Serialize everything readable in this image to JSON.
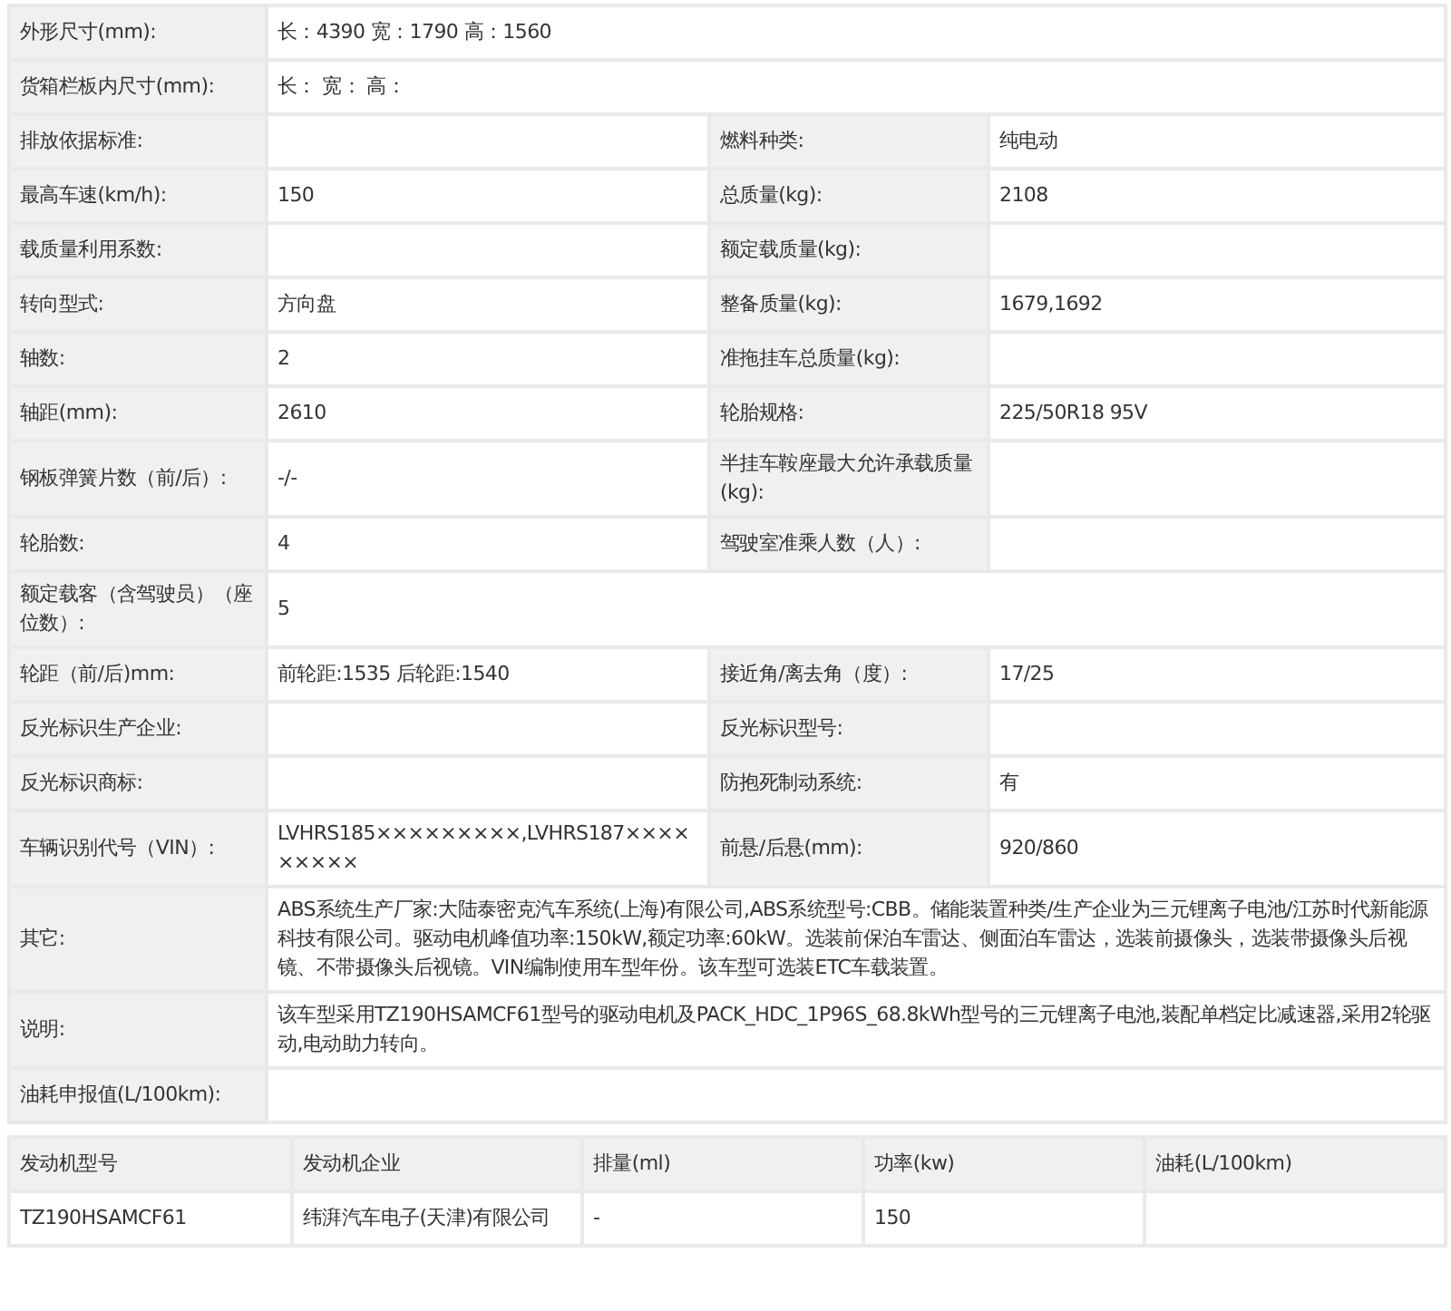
{
  "spec_table": {
    "rows": [
      {
        "cells": [
          {
            "label": "外形尺寸(mm):",
            "value": "长：4390 宽：1790 高：1560"
          }
        ]
      },
      {
        "cells": [
          {
            "label": "货箱栏板内尺寸(mm):",
            "value": "长：  宽：  高："
          }
        ]
      },
      {
        "cells": [
          {
            "label": "排放依据标准:"
          },
          {
            "label": "燃料种类:",
            "value": "纯电动"
          }
        ]
      },
      {
        "cells": [
          {
            "label": "最高车速(km/h):",
            "value": "150"
          },
          {
            "label": "总质量(kg):",
            "value": "2108"
          }
        ]
      },
      {
        "cells": [
          {
            "label": "载质量利用系数:"
          },
          {
            "label": "额定载质量(kg):"
          }
        ]
      },
      {
        "cells": [
          {
            "label": "转向型式:",
            "value": "方向盘"
          },
          {
            "label": "整备质量(kg):",
            "value": "1679,1692"
          }
        ]
      },
      {
        "cells": [
          {
            "label": "轴数:",
            "value": "2"
          },
          {
            "label": "准拖挂车总质量(kg):"
          }
        ]
      },
      {
        "cells": [
          {
            "label": "轴距(mm):",
            "value": "2610"
          },
          {
            "label": "轮胎规格:",
            "value": "225/50R18 95V"
          }
        ]
      },
      {
        "cells": [
          {
            "label": "钢板弹簧片数（前/后）:",
            "value": "-/-"
          },
          {
            "label": "半挂车鞍座最大允许承载质量(kg):"
          }
        ]
      },
      {
        "cells": [
          {
            "label": "轮胎数:",
            "value": "4"
          },
          {
            "label": "驾驶室准乘人数（人）:"
          }
        ]
      },
      {
        "cells": [
          {
            "label": "额定载客（含驾驶员）（座位数）:",
            "value": "5"
          }
        ]
      },
      {
        "cells": [
          {
            "label": "轮距（前/后)mm:",
            "value": "前轮距:1535 后轮距:1540"
          },
          {
            "label": "接近角/离去角（度）:",
            "value": "17/25"
          }
        ]
      },
      {
        "cells": [
          {
            "label": "反光标识生产企业:"
          },
          {
            "label": "反光标识型号:"
          }
        ]
      },
      {
        "cells": [
          {
            "label": "反光标识商标:"
          },
          {
            "label": "防抱死制动系统:",
            "value": "有"
          }
        ]
      },
      {
        "cells": [
          {
            "label": "车辆识别代号（VIN）:",
            "value": "LVHRS185×××××××××,LVHRS187×××××××××"
          },
          {
            "label": "前悬/后悬(mm):",
            "value": "920/860"
          }
        ]
      },
      {
        "cells": [
          {
            "label": "其它:",
            "value": "ABS系统生产厂家:大陆泰密克汽车系统(上海)有限公司,ABS系统型号:CBB。储能装置种类/生产企业为三元锂离子电池/江苏时代新能源科技有限公司。驱动电机峰值功率:150kW,额定功率:60kW。选装前保泊车雷达、侧面泊车雷达，选装前摄像头，选装带摄像头后视镜、不带摄像头后视镜。VIN编制使用车型年份。该车型可选装ETC车载装置。"
          }
        ]
      },
      {
        "cells": [
          {
            "label": "说明:",
            "value": "该车型采用TZ190HSAMCF61型号的驱动电机及PACK_HDC_1P96S_68.8kWh型号的三元锂离子电池,装配单档定比减速器,采用2轮驱动,电动助力转向。"
          }
        ]
      },
      {
        "cells": [
          {
            "label": "油耗申报值(L/100km):"
          }
        ]
      }
    ]
  },
  "engine_table": {
    "columns": [
      "发动机型号",
      "发动机企业",
      "排量(ml)",
      "功率(kw)",
      "油耗(L/100km)"
    ],
    "rows": [
      [
        "TZ190HSAMCF61",
        "纬湃汽车电子(天津)有限公司",
        "-",
        "150"
      ]
    ]
  }
}
